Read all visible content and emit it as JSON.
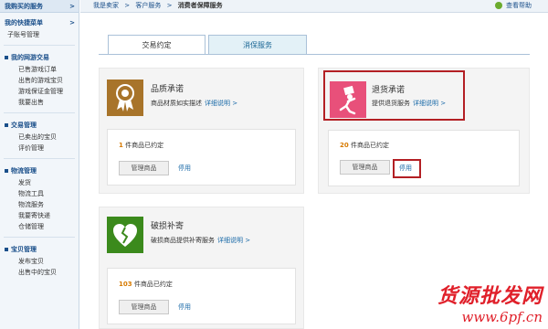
{
  "sidebar": {
    "top_title": "我购买的服务",
    "quick_menu": {
      "title": "我的快捷菜单",
      "items": [
        "子账号管理"
      ]
    },
    "sections": [
      {
        "title": "我的网游交易",
        "items": [
          "已售游戏订单",
          "出售的游戏宝贝",
          "游戏保证金管理",
          "我要出售"
        ]
      },
      {
        "title": "交易管理",
        "items": [
          "已卖出的宝贝",
          "评价管理"
        ]
      },
      {
        "title": "物流管理",
        "items": [
          "发货",
          "物流工具",
          "物流服务",
          "我要寄快递",
          "仓储管理"
        ]
      },
      {
        "title": "宝贝管理",
        "items": [
          "发布宝贝",
          "出售中的宝贝"
        ]
      }
    ],
    "chevron": ">"
  },
  "breadcrumb": {
    "items": [
      "我是卖家",
      ">",
      "客户服务",
      ">"
    ],
    "current": "消费者保障服务"
  },
  "help": "查看帮助",
  "tabs": [
    "交易约定",
    "消保服务"
  ],
  "cards": {
    "quality": {
      "title": "品质承诺",
      "desc": "商品材质如实描述",
      "link": "详细说明 >",
      "count_num": "1",
      "count_text": "件商品已约定",
      "manage": "管理商品",
      "stop": "停用",
      "icon": "medal-icon"
    },
    "return": {
      "title": "退货承诺",
      "desc": "提供退货服务",
      "link": "详细说明 >",
      "count_num": "20",
      "count_text": "件商品已约定",
      "manage": "管理商品",
      "stop": "停用",
      "icon": "return-person-icon"
    },
    "damage": {
      "title": "破损补寄",
      "desc": "破损商品提供补寄服务",
      "link": "详细说明 >",
      "count_num": "103",
      "count_text": "件商品已约定",
      "manage": "管理商品",
      "stop": "停用",
      "icon": "broken-heart-icon"
    }
  },
  "watermark": {
    "cn": "货源批发网",
    "url": "www.6pf.cn"
  },
  "colors": {
    "accent": "#1a4f8a",
    "highlight": "#b31f24",
    "quality_icon": "#a8742a",
    "return_icon": "#e8507a",
    "damage_icon": "#3b8a1c"
  }
}
